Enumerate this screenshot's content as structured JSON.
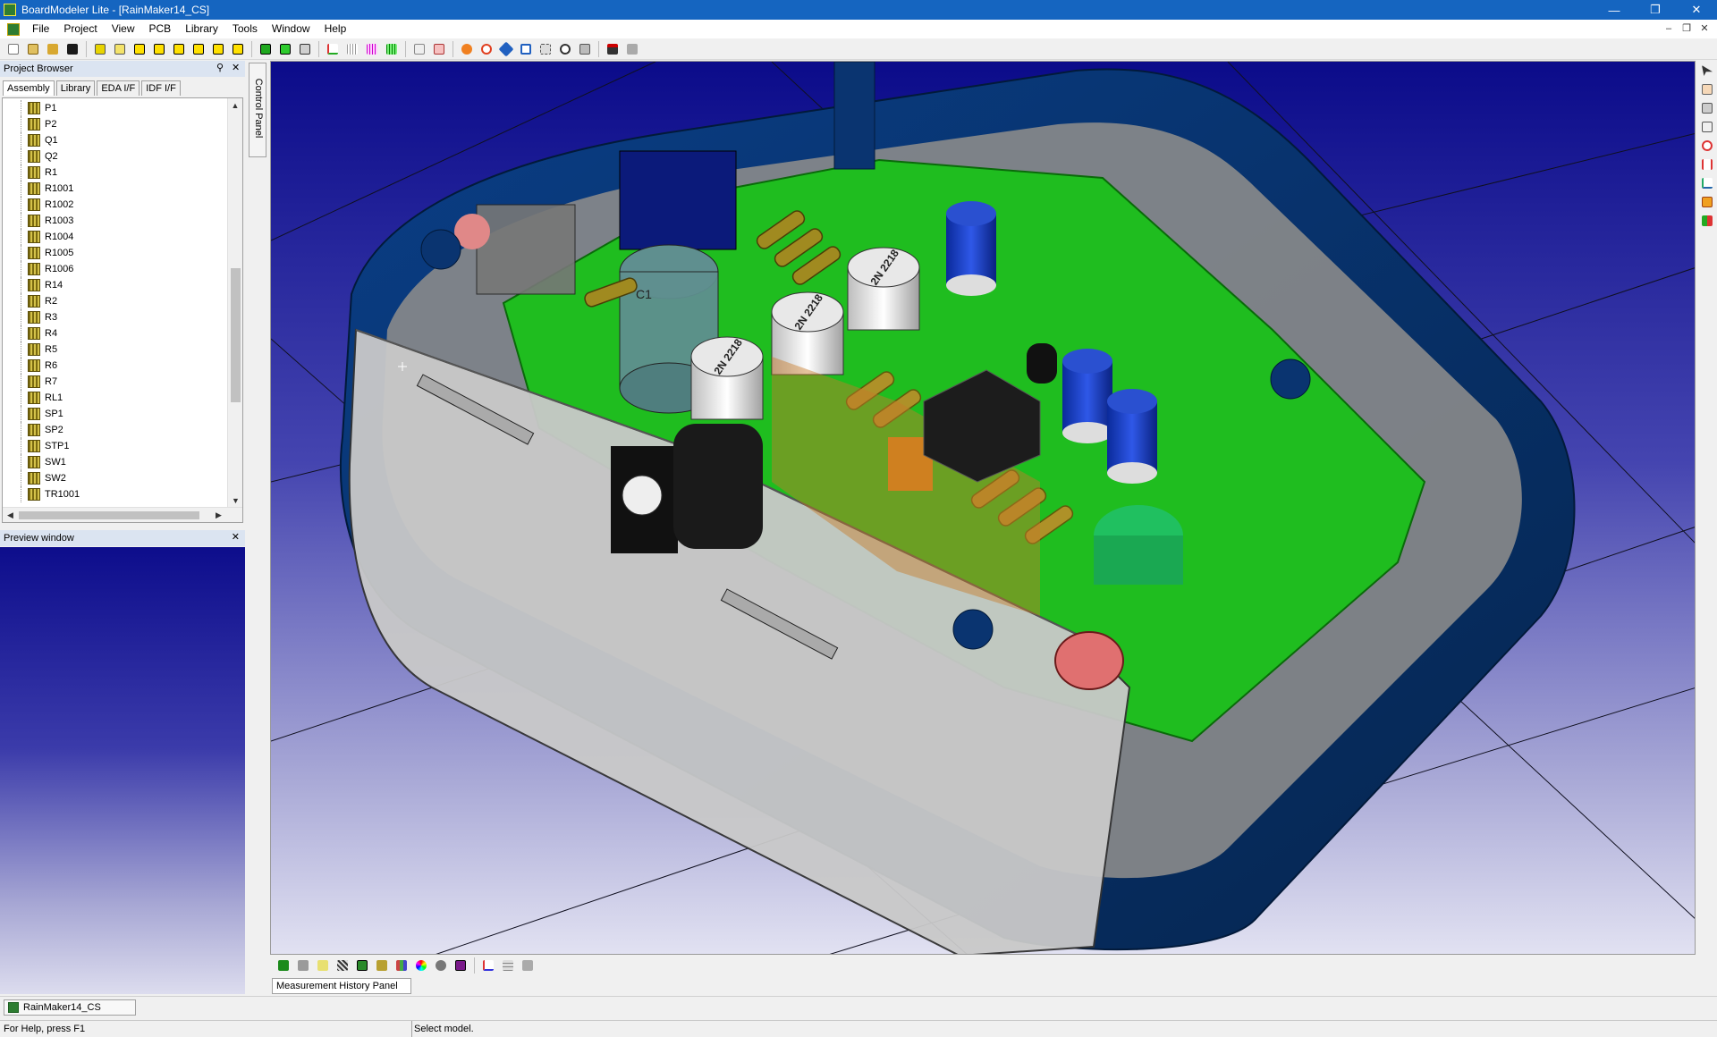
{
  "window": {
    "title": "BoardModeler Lite - [RainMaker14_CS]",
    "controls": [
      "minimize-icon",
      "restore-icon",
      "close-icon"
    ]
  },
  "menu": {
    "items": [
      "File",
      "Project",
      "View",
      "PCB",
      "Library",
      "Tools",
      "Window",
      "Help"
    ]
  },
  "toolbar": {
    "icons": [
      "new-icon",
      "open-icon",
      "open-folder-icon",
      "save-icon",
      "board-yellow-icon",
      "board-outline-icon",
      "component-1-icon",
      "component-2-icon",
      "component-3-icon",
      "component-4-icon",
      "component-5-icon",
      "component-6-icon",
      "green-board-icon",
      "green-cube-icon",
      "layers-icon",
      "axes-icon",
      "grid-icon",
      "colored-grid-icon",
      "green-grid-icon",
      "trace-icon",
      "capture-icon",
      "orange-rotate-icon",
      "orbit-icon",
      "pan-icon",
      "zoom-fit-icon",
      "zoom-window-icon",
      "zoom-dynamic-icon",
      "export-icon",
      "print-icon",
      "print-preview-icon"
    ]
  },
  "project_browser": {
    "title": "Project Browser",
    "tabs": [
      "Assembly",
      "Library",
      "EDA I/F",
      "IDF I/F"
    ],
    "active_tab": "Assembly",
    "items": [
      "P1",
      "P2",
      "Q1",
      "Q2",
      "R1",
      "R1001",
      "R1002",
      "R1003",
      "R1004",
      "R1005",
      "R1006",
      "R14",
      "R2",
      "R3",
      "R4",
      "R5",
      "R6",
      "R7",
      "RL1",
      "SP1",
      "SP2",
      "STP1",
      "SW1",
      "SW2",
      "TR1001"
    ]
  },
  "control_panel": {
    "label": "Control Panel"
  },
  "preview": {
    "title": "Preview window"
  },
  "viewport": {
    "capacitor_marking": "2N 2218",
    "label_c1": "C1"
  },
  "right_toolbar": {
    "icons": [
      "select-arrow-icon",
      "hand-icon",
      "measure-icon",
      "clearance-icon",
      "collision-icon",
      "distance-icon",
      "angle-icon",
      "section-icon",
      "color-check-icon"
    ]
  },
  "bottom_toolbar": {
    "icons": [
      "board-view-icon",
      "top-view-icon",
      "bottom-view-icon",
      "pattern-icon",
      "component-view-icon",
      "lib-view-icon",
      "rgb-icon",
      "color-wheel-icon",
      "settings-icon",
      "purple-box-icon",
      "axis-icon",
      "table-icon",
      "compare-icon"
    ]
  },
  "measurement_panel": {
    "label": "Measurement History Panel"
  },
  "document_tab": {
    "label": "RainMaker14_CS"
  },
  "status": {
    "help": "For Help, press F1",
    "message": "Select model."
  },
  "colors": {
    "title_bar": "#1565c0",
    "viewport_top": "#0d0d8c",
    "pcb_green": "#1fbd1f",
    "enclosure_blue": "#0d3b7a"
  }
}
